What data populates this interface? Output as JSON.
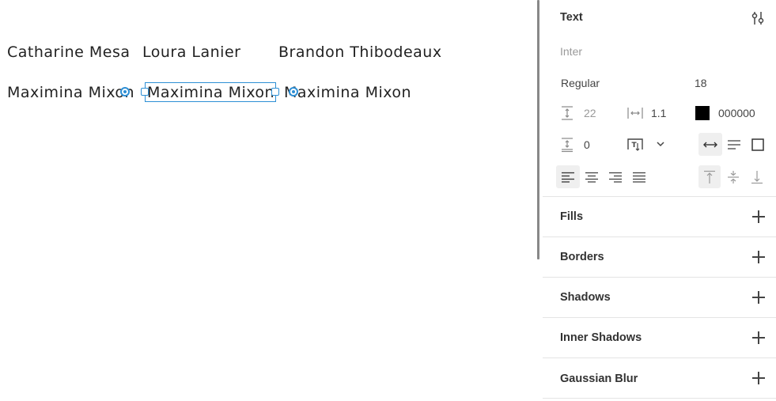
{
  "canvas": {
    "row1": [
      "Catharine Mesa",
      "Loura Lanier",
      "Brandon Thibodeaux"
    ],
    "row2": [
      "Maximina Mixon",
      "Maximina Mixon",
      "Maximina Mixon"
    ]
  },
  "inspector": {
    "title": "Text",
    "font_family": "Inter",
    "font_weight": "Regular",
    "font_size": "18",
    "line_height": "22",
    "letter_spacing": "1.1",
    "color_hex": "000000",
    "color": "#000000",
    "paragraph_spacing": "0",
    "sections": {
      "fills": "Fills",
      "borders": "Borders",
      "shadows": "Shadows",
      "inner_shadows": "Inner Shadows",
      "gaussian_blur": "Gaussian Blur"
    }
  },
  "colors": {
    "selection": "#2d8fd5"
  }
}
